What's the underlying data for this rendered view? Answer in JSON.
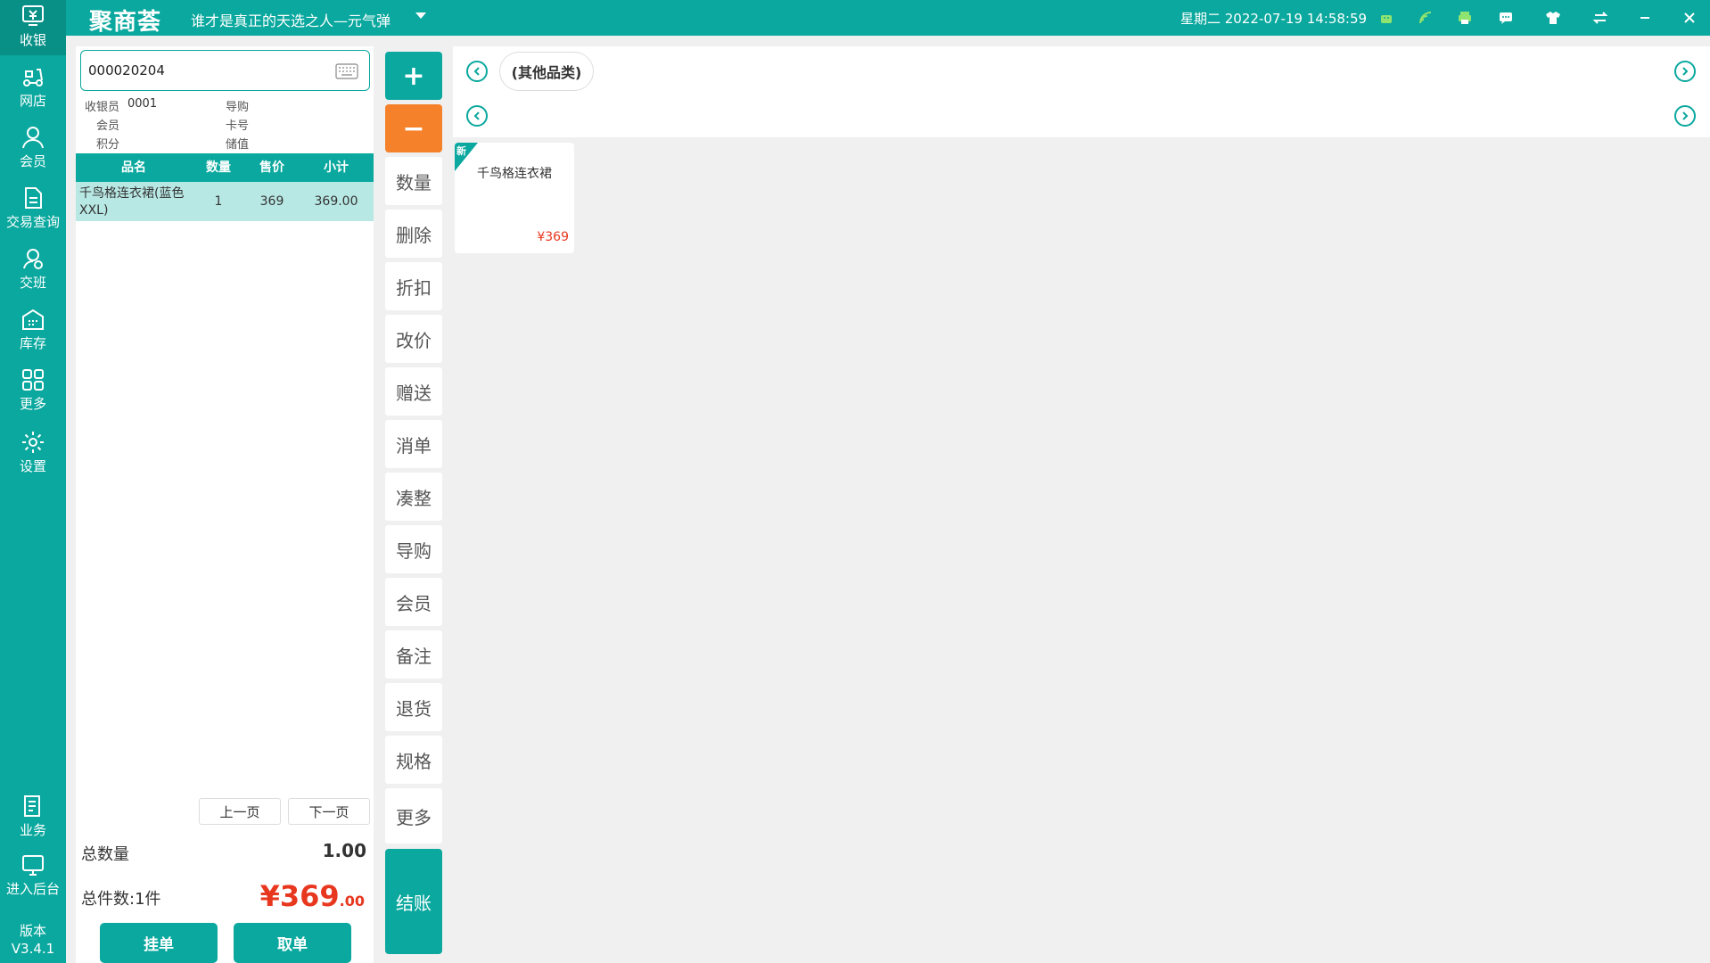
{
  "app": {
    "logo": "聚商荟",
    "slogan": "谁才是真正的天选之人—元气弹",
    "datetime": "星期二 2022-07-19 14:58:59"
  },
  "nav": {
    "items": [
      {
        "label": "收银",
        "icon": "cashier-icon"
      },
      {
        "label": "网店",
        "icon": "scooter-icon"
      },
      {
        "label": "会员",
        "icon": "user-icon"
      },
      {
        "label": "交易查询",
        "icon": "document-icon"
      },
      {
        "label": "交班",
        "icon": "shift-icon"
      },
      {
        "label": "库存",
        "icon": "warehouse-icon"
      },
      {
        "label": "更多",
        "icon": "grid-icon"
      },
      {
        "label": "设置",
        "icon": "gear-icon"
      },
      {
        "label": "业务",
        "icon": "book-icon"
      },
      {
        "label": "进入后台",
        "icon": "monitor-icon"
      }
    ],
    "version_label": "版本",
    "version_value": "V3.4.1"
  },
  "cart": {
    "search_value": "000020204",
    "cashier_label": "收银员",
    "cashier_value": "0001",
    "guide_label": "导购",
    "member_label": "会员",
    "card_label": "卡号",
    "points_label": "积分",
    "stored_label": "储值",
    "columns": [
      "品名",
      "数量",
      "售价",
      "小计"
    ],
    "rows": [
      {
        "name": "千鸟格连衣裙(蓝色XXL)",
        "qty": "1",
        "price": "369",
        "subtotal": "369.00"
      }
    ],
    "prev_page": "上一页",
    "next_page": "下一页",
    "total_qty_label": "总数量",
    "total_qty_value": "1.00",
    "total_items_label": "总件数:1件",
    "total_currency": "¥",
    "total_int": "369",
    "total_dec": ".00",
    "hold_label": "挂单",
    "retrieve_label": "取单"
  },
  "actions": {
    "plus": "+",
    "minus": "−",
    "buttons": [
      "数量",
      "删除",
      "折扣",
      "改价",
      "赠送",
      "消单",
      "凑整",
      "导购",
      "会员",
      "备注",
      "退货",
      "规格",
      "更多"
    ],
    "checkout": "结账"
  },
  "products": {
    "category": "(其他品类)",
    "items": [
      {
        "badge": "新",
        "name": "千鸟格连衣裙",
        "price": "¥369"
      }
    ]
  },
  "colors": {
    "brand": "#0aa89e",
    "minus": "#f5822a",
    "price": "#e8371f"
  }
}
